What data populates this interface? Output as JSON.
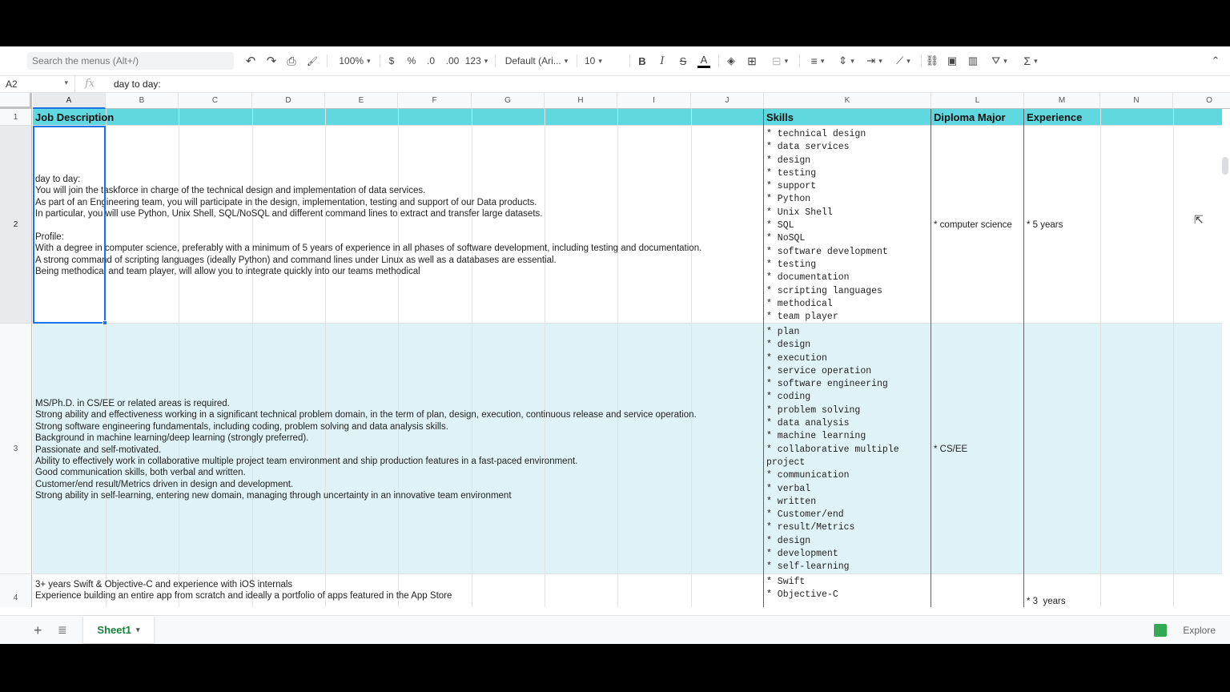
{
  "toolbar": {
    "menu_search_placeholder": "Search the menus (Alt+/)",
    "undo": "↶",
    "redo": "↷",
    "print": "⎙",
    "paint_format": "🖌",
    "zoom": "100%",
    "currency": "$",
    "percent": "%",
    "decrease_decimal": ".0",
    "increase_decimal": ".00",
    "more_formats": "123",
    "font": "Default (Ari...",
    "font_size": "10",
    "bold": "B",
    "italic": "I",
    "strikethrough": "S",
    "text_color": "A",
    "fill_color": "◈",
    "borders": "⊞",
    "merge": "⊟",
    "halign": "≡",
    "valign": "⇕",
    "wrap": "⇥",
    "rotate": "⟋",
    "link": "⛓",
    "comment": "▣",
    "chart": "▥",
    "filter": "⛛",
    "functions": "Σ",
    "collapse": "⌃"
  },
  "formula_bar": {
    "cell_ref": "A2",
    "fx": "fx",
    "value": "day to day:"
  },
  "columns": [
    "A",
    "B",
    "C",
    "D",
    "E",
    "F",
    "G",
    "H",
    "I",
    "J",
    "K",
    "L",
    "M",
    "N",
    "O"
  ],
  "rows": [
    "1",
    "2",
    "3",
    "4"
  ],
  "header_row": {
    "job_description": "Job Description",
    "skills": "Skills",
    "diploma_major": "Diploma Major",
    "experience": "Experience"
  },
  "row2": {
    "description": "day to day:\nYou will join the taskforce in charge of the technical design and implementation of data services.\nAs part of an Engineering team, you will participate in the design, implementation, testing and support of our Data products.\nIn particular, you will use Python, Unix Shell, SQL/NoSQL and different command lines to extract and transfer large datasets.\n\nProfile:\nWith a degree in computer science, preferably with a minimum of 5 years of experience in all phases of software development, including testing and documentation.\nA strong command of scripting languages (ideally Python) and command lines under Linux as well as a databases are essential.\nBeing methodical and team player, will allow you to integrate quickly into our teams methodical",
    "skills": "* technical design\n* data services\n* design\n* testing\n* support\n* Python\n* Unix Shell\n* SQL\n* NoSQL\n* software development\n* testing\n* documentation\n* scripting languages\n* methodical\n* team player",
    "diploma": "* computer science",
    "experience": "* 5 years"
  },
  "row3": {
    "description": "MS/Ph.D. in CS/EE or related areas is required.\nStrong ability and effectiveness working in a significant technical problem domain, in the term of plan, design, execution, continuous release and service operation.\nStrong software engineering fundamentals, including coding, problem solving and data analysis skills.\nBackground in machine learning/deep learning (strongly preferred).\nPassionate and self-motivated.\nAbility to effectively work in collaborative multiple project team environment and ship production features in a fast-paced environment.\nGood communication skills, both verbal and written.\nCustomer/end result/Metrics driven in design and development.\nStrong ability in self-learning, entering new domain, managing through uncertainty in an innovative team environment",
    "skills": "* plan\n* design\n* execution\n* service operation\n* software engineering\n* coding\n* problem solving\n* data analysis\n* machine learning\n* collaborative multiple\nproject\n* communication\n* verbal\n* written\n* Customer/end\n* result/Metrics\n* design\n* development\n* self-learning",
    "diploma": "* CS/EE",
    "experience": ""
  },
  "row4": {
    "description": "3+ years Swift & Objective-C and experience with iOS internals\nExperience building an entire app from scratch and ideally a portfolio of apps featured in the App Store",
    "skills": "* Swift\n* Objective-C",
    "diploma": "",
    "experience": "* 3  years"
  },
  "bottom": {
    "add_sheet": "+",
    "all_sheets": "≣",
    "sheet_name": "Sheet1",
    "explore": "Explore"
  }
}
